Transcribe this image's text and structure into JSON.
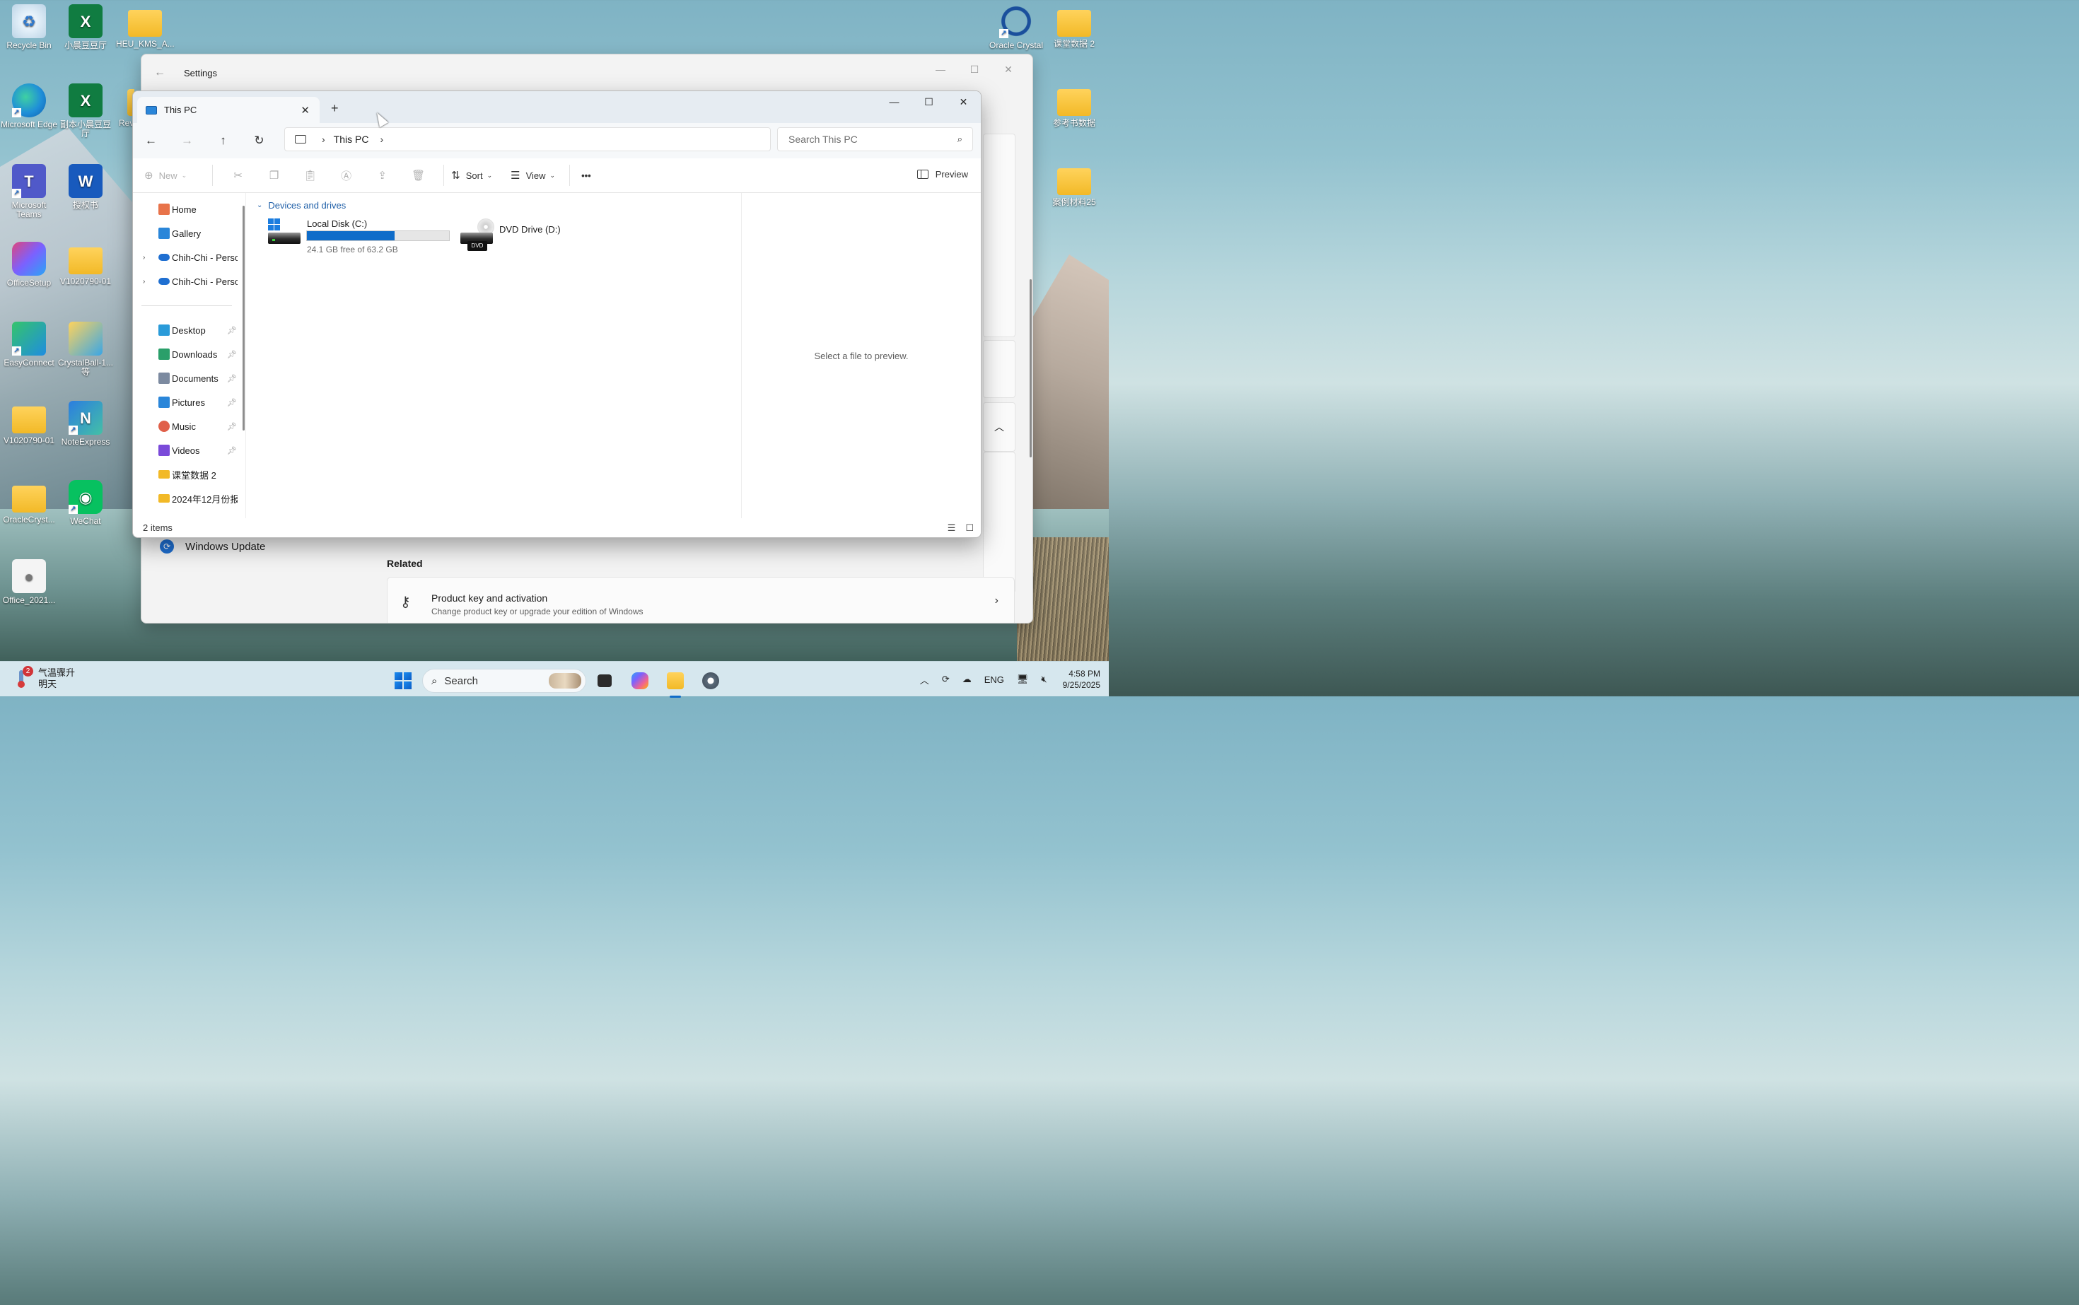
{
  "desktop": {
    "icons_left": [
      {
        "label": "Recycle Bin",
        "kind": "recycle"
      },
      {
        "label": "小晨豆豆厅",
        "kind": "excel"
      },
      {
        "label": "HEU_KMS_A...",
        "kind": "folder"
      },
      {
        "label": "Microsoft Edge",
        "kind": "edge"
      },
      {
        "label": "副本小晨豆豆厅",
        "kind": "excel"
      },
      {
        "label": "Rev",
        "kind": "folder"
      },
      {
        "label": "Microsoft Teams",
        "kind": "teams"
      },
      {
        "label": "授权书",
        "kind": "word"
      },
      {
        "label": "OfficeSetup",
        "kind": "office"
      },
      {
        "label": "V1020790-01",
        "kind": "folder"
      },
      {
        "label": "EasyConnect",
        "kind": "easy"
      },
      {
        "label": "CrystalBall-1... 等",
        "kind": "crystal"
      },
      {
        "label": "V1020790-01",
        "kind": "folder"
      },
      {
        "label": "NoteExpress",
        "kind": "note"
      },
      {
        "label": "OracleCryst...",
        "kind": "folder"
      },
      {
        "label": "WeChat",
        "kind": "wechat"
      },
      {
        "label": "Office_2021...",
        "kind": "doc"
      }
    ],
    "icons_right": [
      {
        "label": "Oracle Crystal",
        "kind": "oracle"
      },
      {
        "label": "课堂数据 2",
        "kind": "folder"
      },
      {
        "label": "参考书数据",
        "kind": "folder"
      },
      {
        "label": "案例材料25",
        "kind": "folder"
      }
    ]
  },
  "settings": {
    "title": "Settings",
    "windows_update": "Windows Update",
    "related_heading": "Related",
    "product_key_title": "Product key and activation",
    "product_key_desc": "Change product key or upgrade your edition of Windows"
  },
  "explorer": {
    "tab_title": "This PC",
    "breadcrumb": [
      "This PC"
    ],
    "search_placeholder": "Search This PC",
    "commands": {
      "new": "New",
      "sort": "Sort",
      "view": "View",
      "more": "•••",
      "preview": "Preview"
    },
    "nav": [
      {
        "label": "Home",
        "icon": "home-icon",
        "color": "#e8734a",
        "expandable": false,
        "pinned": false
      },
      {
        "label": "Gallery",
        "icon": "gallery-icon",
        "color": "#2a86d9",
        "expandable": false,
        "pinned": false
      },
      {
        "label": "Chih-Chi - Personal",
        "icon": "onedrive-icon",
        "color": "#1f6fd1",
        "expandable": true,
        "pinned": false
      },
      {
        "label": "Chih-Chi - Personal",
        "icon": "onedrive-icon",
        "color": "#1f6fd1",
        "expandable": true,
        "pinned": false
      },
      {
        "label": "Desktop",
        "icon": "desktop-icon",
        "color": "#2a9bd9",
        "expandable": false,
        "pinned": true
      },
      {
        "label": "Downloads",
        "icon": "downloads-icon",
        "color": "#2a9f6a",
        "expandable": false,
        "pinned": true
      },
      {
        "label": "Documents",
        "icon": "documents-icon",
        "color": "#7c8aa0",
        "expandable": false,
        "pinned": true
      },
      {
        "label": "Pictures",
        "icon": "pictures-icon",
        "color": "#2a86d9",
        "expandable": false,
        "pinned": true
      },
      {
        "label": "Music",
        "icon": "music-icon",
        "color": "#e0604a",
        "expandable": false,
        "pinned": true
      },
      {
        "label": "Videos",
        "icon": "videos-icon",
        "color": "#7a4ad9",
        "expandable": false,
        "pinned": true
      },
      {
        "label": "课堂数据 2",
        "icon": "folder-icon",
        "color": "#f2b927",
        "expandable": false,
        "pinned": false
      },
      {
        "label": "2024年12月份报",
        "icon": "folder-icon",
        "color": "#f2b927",
        "expandable": false,
        "pinned": false
      }
    ],
    "group_header": "Devices and drives",
    "drives": [
      {
        "name": "Local Disk (C:)",
        "free_text": "24.1 GB free of 63.2 GB",
        "used_fraction": 0.619
      },
      {
        "name": "DVD Drive (D:)",
        "tag": "DVD"
      }
    ],
    "preview_message": "Select a file to preview.",
    "status": "2 items"
  },
  "taskbar": {
    "weather_badge": "2",
    "weather_line1": "气温骤升",
    "weather_line2": "明天",
    "search_label": "Search",
    "lang": "ENG",
    "time": "4:58 PM",
    "date": "9/25/2025"
  }
}
